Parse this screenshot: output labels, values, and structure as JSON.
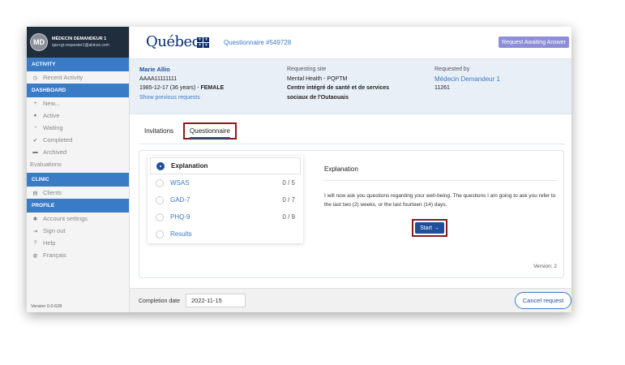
{
  "user": {
    "initials": "MD",
    "name": "MÉDECIN DEMANDEUR 1",
    "email": "qax+gr.requester1@akinox.com"
  },
  "sidebar": {
    "activity_title": "ACTIVITY",
    "recent_activity": "Recent Activity",
    "dashboard_title": "DASHBOARD",
    "dashboard_items": [
      "New...",
      "Active",
      "Waiting",
      "Completed",
      "Archived",
      "Evaluations"
    ],
    "clinic_title": "CLINIC",
    "clients": "Clients",
    "profile_title": "PROFILE",
    "profile_items": [
      "Account settings",
      "Sign out",
      "Help",
      "Français"
    ],
    "version": "Version 0.0.628"
  },
  "header": {
    "logo": "Québec",
    "questionnaire_number": "Questionnaire  #549728",
    "status_badge": "Request Awaiting Answer"
  },
  "patient": {
    "name": "Marie Allio",
    "id": "AAAA11111111",
    "dob_prefix": "1985-12-17 (36 years) - ",
    "sex": "FEMALE",
    "show_previous": "Show previous requests"
  },
  "site": {
    "label": "Requesting site",
    "name": "Mental Health - PQPTM",
    "org_line1": "Centre intégré de santé et de services",
    "org_line2": "sociaux de l'Outaouais"
  },
  "requester": {
    "label": "Requested by",
    "name": "Médecin Demandeur 1",
    "number": "11261"
  },
  "tabs": {
    "invitations": "Invitations",
    "questionnaire": "Questionnaire"
  },
  "steps": [
    {
      "label": "Explanation",
      "score": ""
    },
    {
      "label": "WSAS",
      "score": "0 / 5"
    },
    {
      "label": "GAD-7",
      "score": "0 / 7"
    },
    {
      "label": "PHQ-9",
      "score": "0 / 9"
    },
    {
      "label": "Results",
      "score": ""
    }
  ],
  "explanation": {
    "title": "Explanation",
    "text": "I will now ask you questions regarding your well-being. The questions I am going to ask you refer to the last two (2) weeks, or the last fourteen (14) days.",
    "start": "Start →",
    "version": "Version: 2"
  },
  "footer": {
    "completion_label": "Completion date",
    "completion_value": "2022-11-15",
    "cancel": "Cancel request"
  }
}
